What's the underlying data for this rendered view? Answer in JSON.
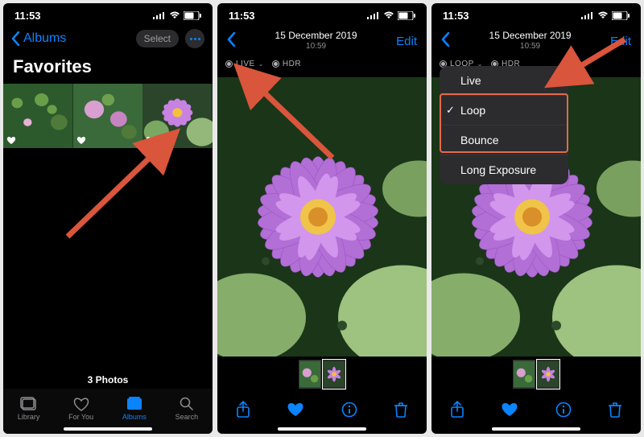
{
  "status": {
    "time": "11:53"
  },
  "screen1": {
    "back_label": "Albums",
    "select_label": "Select",
    "title": "Favorites",
    "count": "3 Photos",
    "tabs": [
      {
        "label": "Library"
      },
      {
        "label": "For You"
      },
      {
        "label": "Albums"
      },
      {
        "label": "Search"
      }
    ]
  },
  "screen2": {
    "date": "15 December 2019",
    "time": "10:59",
    "edit": "Edit",
    "badge1": "LIVE",
    "badge2": "HDR"
  },
  "screen3": {
    "date": "15 December 2019",
    "time": "10:59",
    "edit": "Edit",
    "badge1": "LOOP",
    "badge2": "HDR",
    "menu": {
      "items": [
        {
          "label": "Live",
          "checked": false
        },
        {
          "label": "Loop",
          "checked": true
        },
        {
          "label": "Bounce",
          "checked": false
        },
        {
          "label": "Long Exposure",
          "checked": false
        }
      ]
    }
  }
}
